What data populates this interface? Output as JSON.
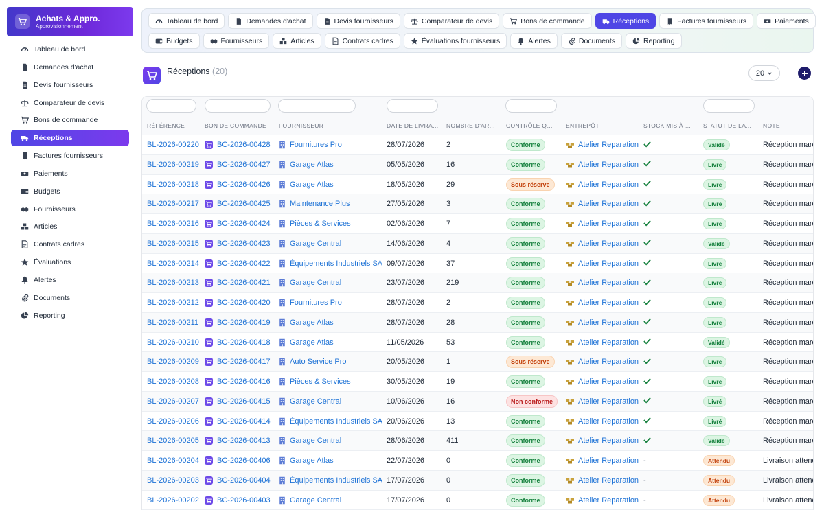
{
  "brand": {
    "title": "Achats & Appro.",
    "subtitle": "Approvisionnement",
    "icon": "cart-icon"
  },
  "sidebar": {
    "items": [
      {
        "label": "Tableau de bord",
        "icon": "gauge-icon",
        "active": false
      },
      {
        "label": "Demandes d'achat",
        "icon": "file-icon",
        "active": false
      },
      {
        "label": "Devis fournisseurs",
        "icon": "file-text-icon",
        "active": false
      },
      {
        "label": "Comparateur de devis",
        "icon": "scale-icon",
        "active": false
      },
      {
        "label": "Bons de commande",
        "icon": "cart-icon",
        "active": false
      },
      {
        "label": "Réceptions",
        "icon": "truck-icon",
        "active": true
      },
      {
        "label": "Factures fournisseurs",
        "icon": "invoice-icon",
        "active": false
      },
      {
        "label": "Paiements",
        "icon": "money-icon",
        "active": false
      },
      {
        "label": "Budgets",
        "icon": "wallet-icon",
        "active": false
      },
      {
        "label": "Fournisseurs",
        "icon": "handshake-icon",
        "active": false
      },
      {
        "label": "Articles",
        "icon": "boxes-icon",
        "active": false
      },
      {
        "label": "Contrats cadres",
        "icon": "contract-icon",
        "active": false
      },
      {
        "label": "Évaluations",
        "icon": "star-icon",
        "active": false
      },
      {
        "label": "Alertes",
        "icon": "bell-icon",
        "active": false
      },
      {
        "label": "Documents",
        "icon": "paperclip-icon",
        "active": false
      },
      {
        "label": "Reporting",
        "icon": "pie-chart-icon",
        "active": false
      }
    ]
  },
  "tabs": {
    "row1": [
      {
        "label": "Tableau de bord",
        "icon": "gauge-icon",
        "active": false
      },
      {
        "label": "Demandes d'achat",
        "icon": "file-icon",
        "active": false
      },
      {
        "label": "Devis fournisseurs",
        "icon": "file-text-icon",
        "active": false
      },
      {
        "label": "Comparateur de devis",
        "icon": "scale-icon",
        "active": false
      },
      {
        "label": "Bons de commande",
        "icon": "cart-icon",
        "active": false
      },
      {
        "label": "Réceptions",
        "icon": "truck-icon",
        "active": true
      },
      {
        "label": "Factures fournisseurs",
        "icon": "invoice-icon",
        "active": false
      },
      {
        "label": "Paiements",
        "icon": "money-icon",
        "active": false
      }
    ],
    "row2": [
      {
        "label": "Budgets",
        "icon": "wallet-icon",
        "active": false
      },
      {
        "label": "Fournisseurs",
        "icon": "handshake-icon",
        "active": false
      },
      {
        "label": "Articles",
        "icon": "boxes-icon",
        "active": false
      },
      {
        "label": "Contrats cadres",
        "icon": "contract-icon",
        "active": false
      },
      {
        "label": "Évaluations fournisseurs",
        "icon": "star-icon",
        "active": false
      },
      {
        "label": "Alertes",
        "icon": "bell-icon",
        "active": false
      },
      {
        "label": "Documents",
        "icon": "paperclip-icon",
        "active": false
      },
      {
        "label": "Reporting",
        "icon": "pie-chart-icon",
        "active": false
      }
    ]
  },
  "header": {
    "title": "Réceptions",
    "count": "(20)",
    "page_size": "20"
  },
  "table": {
    "columns": [
      "RÉFÉRENCE",
      "BON DE COMMANDE",
      "FOURNISSEUR",
      "DATE DE LIVRAISON",
      "NOMBRE D'ARTICLES",
      "CONTRÔLE QUALITÉ",
      "ENTREPÔT",
      "STOCK MIS À JOUR",
      "STATUT DE LA LIVRAISON",
      "NOTE"
    ],
    "rows": [
      {
        "ref": "BL-2026-00220",
        "bc": "BC-2026-00428",
        "supplier": "Fournitures Pro",
        "date": "28/07/2026",
        "qty": "2",
        "qc": "Conforme",
        "qc_type": "ok",
        "warehouse": "Atelier Reparation",
        "stock": true,
        "status": "Validé",
        "status_type": "ok",
        "note": "Réception marchandises"
      },
      {
        "ref": "BL-2026-00219",
        "bc": "BC-2026-00427",
        "supplier": "Garage Atlas",
        "date": "05/05/2026",
        "qty": "16",
        "qc": "Conforme",
        "qc_type": "ok",
        "warehouse": "Atelier Reparation",
        "stock": true,
        "status": "Livré",
        "status_type": "ok",
        "note": "Réception marchandises"
      },
      {
        "ref": "BL-2026-00218",
        "bc": "BC-2026-00426",
        "supplier": "Garage Atlas",
        "date": "18/05/2026",
        "qty": "29",
        "qc": "Sous réserve",
        "qc_type": "warn",
        "warehouse": "Atelier Reparation",
        "stock": true,
        "status": "Livré",
        "status_type": "ok",
        "note": "Réception marchandises"
      },
      {
        "ref": "BL-2026-00217",
        "bc": "BC-2026-00425",
        "supplier": "Maintenance Plus",
        "date": "27/05/2026",
        "qty": "3",
        "qc": "Conforme",
        "qc_type": "ok",
        "warehouse": "Atelier Reparation",
        "stock": true,
        "status": "Livré",
        "status_type": "ok",
        "note": "Réception marchandises"
      },
      {
        "ref": "BL-2026-00216",
        "bc": "BC-2026-00424",
        "supplier": "Pièces & Services",
        "date": "02/06/2026",
        "qty": "7",
        "qc": "Conforme",
        "qc_type": "ok",
        "warehouse": "Atelier Reparation",
        "stock": true,
        "status": "Livré",
        "status_type": "ok",
        "note": "Réception marchandises"
      },
      {
        "ref": "BL-2026-00215",
        "bc": "BC-2026-00423",
        "supplier": "Garage Central",
        "date": "14/06/2026",
        "qty": "4",
        "qc": "Conforme",
        "qc_type": "ok",
        "warehouse": "Atelier Reparation",
        "stock": true,
        "status": "Validé",
        "status_type": "ok",
        "note": "Réception marchandises"
      },
      {
        "ref": "BL-2026-00214",
        "bc": "BC-2026-00422",
        "supplier": "Équipements Industriels SA",
        "date": "09/07/2026",
        "qty": "37",
        "qc": "Conforme",
        "qc_type": "ok",
        "warehouse": "Atelier Reparation",
        "stock": true,
        "status": "Livré",
        "status_type": "ok",
        "note": "Réception marchandises"
      },
      {
        "ref": "BL-2026-00213",
        "bc": "BC-2026-00421",
        "supplier": "Garage Central",
        "date": "23/07/2026",
        "qty": "219",
        "qc": "Conforme",
        "qc_type": "ok",
        "warehouse": "Atelier Reparation",
        "stock": true,
        "status": "Livré",
        "status_type": "ok",
        "note": "Réception marchandises"
      },
      {
        "ref": "BL-2026-00212",
        "bc": "BC-2026-00420",
        "supplier": "Fournitures Pro",
        "date": "28/07/2026",
        "qty": "2",
        "qc": "Conforme",
        "qc_type": "ok",
        "warehouse": "Atelier Reparation",
        "stock": true,
        "status": "Livré",
        "status_type": "ok",
        "note": "Réception marchandises"
      },
      {
        "ref": "BL-2026-00211",
        "bc": "BC-2026-00419",
        "supplier": "Garage Atlas",
        "date": "28/07/2026",
        "qty": "28",
        "qc": "Conforme",
        "qc_type": "ok",
        "warehouse": "Atelier Reparation",
        "stock": true,
        "status": "Livré",
        "status_type": "ok",
        "note": "Réception marchandises"
      },
      {
        "ref": "BL-2026-00210",
        "bc": "BC-2026-00418",
        "supplier": "Garage Atlas",
        "date": "11/05/2026",
        "qty": "53",
        "qc": "Conforme",
        "qc_type": "ok",
        "warehouse": "Atelier Reparation",
        "stock": true,
        "status": "Validé",
        "status_type": "ok",
        "note": "Réception marchandises"
      },
      {
        "ref": "BL-2026-00209",
        "bc": "BC-2026-00417",
        "supplier": "Auto Service Pro",
        "date": "20/05/2026",
        "qty": "1",
        "qc": "Sous réserve",
        "qc_type": "warn",
        "warehouse": "Atelier Reparation",
        "stock": true,
        "status": "Livré",
        "status_type": "ok",
        "note": "Réception marchandises"
      },
      {
        "ref": "BL-2026-00208",
        "bc": "BC-2026-00416",
        "supplier": "Pièces & Services",
        "date": "30/05/2026",
        "qty": "19",
        "qc": "Conforme",
        "qc_type": "ok",
        "warehouse": "Atelier Reparation",
        "stock": true,
        "status": "Livré",
        "status_type": "ok",
        "note": "Réception marchandises"
      },
      {
        "ref": "BL-2026-00207",
        "bc": "BC-2026-00415",
        "supplier": "Garage Central",
        "date": "10/06/2026",
        "qty": "16",
        "qc": "Non conforme",
        "qc_type": "bad",
        "warehouse": "Atelier Reparation",
        "stock": true,
        "status": "Livré",
        "status_type": "ok",
        "note": "Réception marchandises"
      },
      {
        "ref": "BL-2026-00206",
        "bc": "BC-2026-00414",
        "supplier": "Équipements Industriels SA",
        "date": "20/06/2026",
        "qty": "13",
        "qc": "Conforme",
        "qc_type": "ok",
        "warehouse": "Atelier Reparation",
        "stock": true,
        "status": "Livré",
        "status_type": "ok",
        "note": "Réception marchandises"
      },
      {
        "ref": "BL-2026-00205",
        "bc": "BC-2026-00413",
        "supplier": "Garage Central",
        "date": "28/06/2026",
        "qty": "411",
        "qc": "Conforme",
        "qc_type": "ok",
        "warehouse": "Atelier Reparation",
        "stock": true,
        "status": "Validé",
        "status_type": "ok",
        "note": "Réception marchandises"
      },
      {
        "ref": "BL-2026-00204",
        "bc": "BC-2026-00406",
        "supplier": "Garage Atlas",
        "date": "22/07/2026",
        "qty": "0",
        "qc": "Conforme",
        "qc_type": "ok",
        "warehouse": "Atelier Reparation",
        "stock": false,
        "status": "Attendu",
        "status_type": "wait",
        "note": "Livraison attendue"
      },
      {
        "ref": "BL-2026-00203",
        "bc": "BC-2026-00404",
        "supplier": "Équipements Industriels SA",
        "date": "17/07/2026",
        "qty": "0",
        "qc": "Conforme",
        "qc_type": "ok",
        "warehouse": "Atelier Reparation",
        "stock": false,
        "status": "Attendu",
        "status_type": "wait",
        "note": "Livraison attendue"
      },
      {
        "ref": "BL-2026-00202",
        "bc": "BC-2026-00403",
        "supplier": "Garage Central",
        "date": "17/07/2026",
        "qty": "0",
        "qc": "Conforme",
        "qc_type": "ok",
        "warehouse": "Atelier Reparation",
        "stock": false,
        "status": "Attendu",
        "status_type": "wait",
        "note": "Livraison attendue"
      }
    ],
    "stock_empty": "-"
  },
  "colors": {
    "accent": "#4f46e5",
    "link": "#1d72d6",
    "ok": "#15803d",
    "warn": "#c2410c",
    "bad": "#b91c1c"
  }
}
